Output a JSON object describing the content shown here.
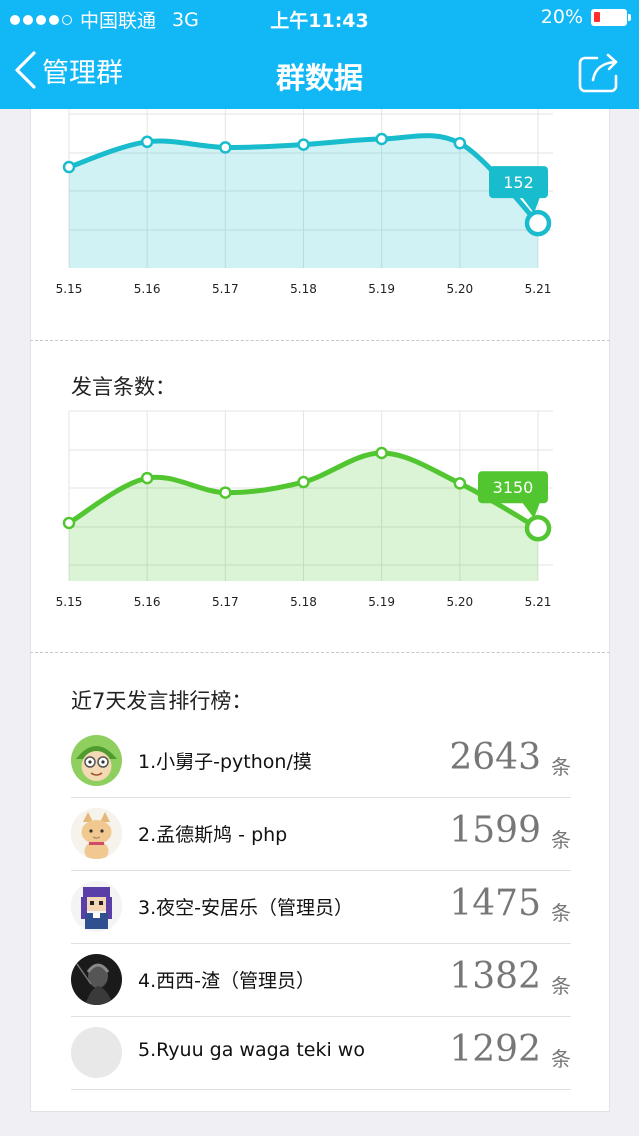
{
  "status_bar": {
    "carrier": "中国联通",
    "network": "3G",
    "time": "上午11:43",
    "battery": "20%",
    "battery_level": 0.2
  },
  "nav": {
    "back_label": "管理群",
    "title": "群数据",
    "back_icon": "chevron-left-icon",
    "share_icon": "share-icon"
  },
  "colors": {
    "header": "#12b7f5",
    "chart_teal": "#19bccc",
    "chart_green": "#52c631"
  },
  "sections": {
    "messages_title": "发言条数：",
    "ranking_title": "近7天发言排行榜："
  },
  "chart_data": [
    {
      "type": "area",
      "categories": [
        "5.15",
        "5.16",
        "5.17",
        "5.18",
        "5.19",
        "5.20",
        "5.21"
      ],
      "series": [
        {
          "values": [
            192,
            210,
            206,
            208,
            212,
            209,
            152
          ]
        }
      ],
      "highlight": {
        "index": 6,
        "label": "152"
      },
      "grid": true,
      "color": "#19bccc"
    },
    {
      "type": "area",
      "categories": [
        "5.15",
        "5.16",
        "5.17",
        "5.18",
        "5.19",
        "5.20",
        "5.21"
      ],
      "series": [
        {
          "values": [
            3190,
            3530,
            3420,
            3500,
            3720,
            3490,
            3150
          ]
        }
      ],
      "highlight": {
        "index": 6,
        "label": "3150"
      },
      "grid": true,
      "color": "#52c631"
    }
  ],
  "ranking": {
    "unit": "条",
    "items": [
      {
        "name": "1.小舅子-python/摸",
        "count": "2643"
      },
      {
        "name": "2.孟德斯鸠 - php",
        "count": "1599"
      },
      {
        "name": "3.夜空-安居乐（管理员）",
        "count": "1475"
      },
      {
        "name": "4.西西-渣（管理员）",
        "count": "1382"
      },
      {
        "name": "5.Ryuu ga waga teki wo",
        "count": "1292"
      }
    ]
  }
}
